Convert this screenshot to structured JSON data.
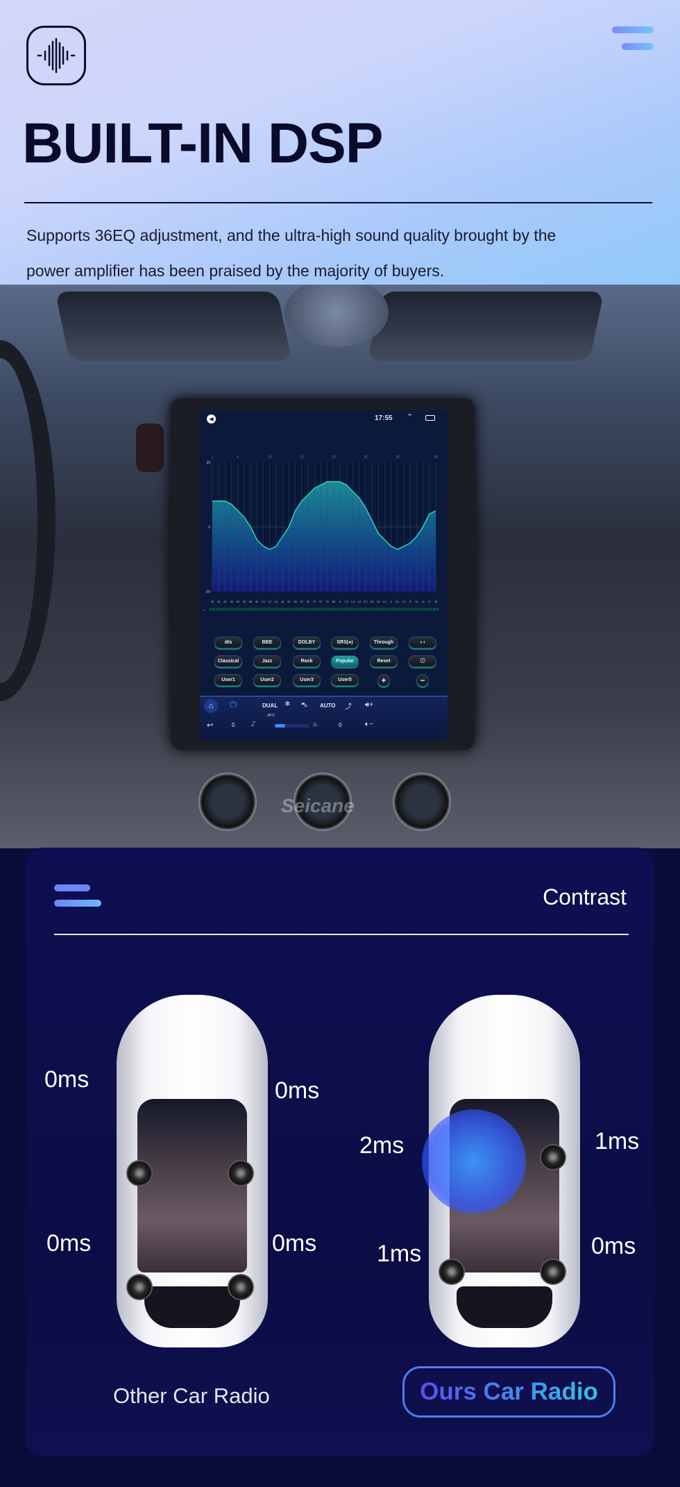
{
  "header": {
    "logo_icon": "sound-wave-icon",
    "menu_icon": "menu-icon",
    "title": "BUILT-IN DSP",
    "description_line1": "Supports 36EQ adjustment, and the ultra-high sound quality brought by the",
    "description_line2": "power amplifier has been praised by the majority of buyers."
  },
  "photo": {
    "watermark": "Seicane"
  },
  "screen": {
    "time": "17:55",
    "eq": {
      "band_numbers": [
        "1",
        "5",
        "10",
        "15",
        "20",
        "25",
        "30",
        "36"
      ],
      "y_ticks": [
        "20",
        "0",
        "-20"
      ],
      "ylim": [
        -20,
        20
      ],
      "gains": [
        8,
        8,
        8,
        7,
        5,
        3,
        0,
        -4,
        -6,
        -7,
        -6,
        -3,
        0,
        5,
        8,
        10,
        12,
        13,
        14,
        14,
        14,
        13,
        11,
        9,
        6,
        2,
        -2,
        -4,
        -6,
        -7,
        -6,
        -5,
        -3,
        0,
        4,
        5
      ],
      "frequencies": [
        "20",
        "24",
        "29",
        "36",
        "45",
        "53",
        "65",
        "80",
        "100",
        "12",
        "14",
        "18",
        "20",
        "26",
        "32",
        "39",
        "47",
        "57",
        "70",
        "85",
        "1k",
        "1.3",
        "1.6",
        "1.9",
        "2.3",
        "2.8",
        "3.4",
        "4.1",
        "5",
        "6.1",
        "7.5",
        "9",
        "11",
        "14",
        "17",
        "20"
      ],
      "g_label": "G",
      "q_label": "Q",
      "g_values": [
        "8",
        "8",
        "8",
        "7",
        "5",
        "3",
        "0",
        "4",
        "6",
        "7",
        "6",
        "3",
        "0",
        "5",
        "8",
        "10",
        "12",
        "13",
        "14",
        "14",
        "14",
        "13",
        "11",
        "9",
        "6",
        "2",
        "2",
        "4",
        "6",
        "7",
        "6",
        "5",
        "3",
        "0",
        "4",
        "5"
      ],
      "q_value": "16",
      "line_color": "#2ad4c4"
    },
    "buttons": [
      [
        "dts",
        "BBE",
        "DOLBY",
        "SRS(●)",
        "Through",
        ""
      ],
      [
        "Classical",
        "Jazz",
        "Rock",
        "Popular",
        "Reset",
        ""
      ],
      [
        "User1",
        "User2",
        "User3",
        "User5",
        "+",
        "−"
      ]
    ],
    "active_button": "Popular",
    "climate": {
      "dual": "DUAL",
      "auto": "AUTO",
      "temp": "24°C",
      "left_value": "0",
      "right_value": "0",
      "fan_level": 0.3
    }
  },
  "contrast": {
    "title": "Contrast",
    "other": {
      "label": "Other Car Radio",
      "delays": [
        "0ms",
        "0ms",
        "0ms",
        "0ms"
      ]
    },
    "ours": {
      "label": "Ours Car Radio",
      "delays": [
        "2ms",
        "1ms",
        "1ms",
        "0ms"
      ]
    },
    "accent_from": "#5b4cf0",
    "accent_to": "#2fc3e8"
  }
}
